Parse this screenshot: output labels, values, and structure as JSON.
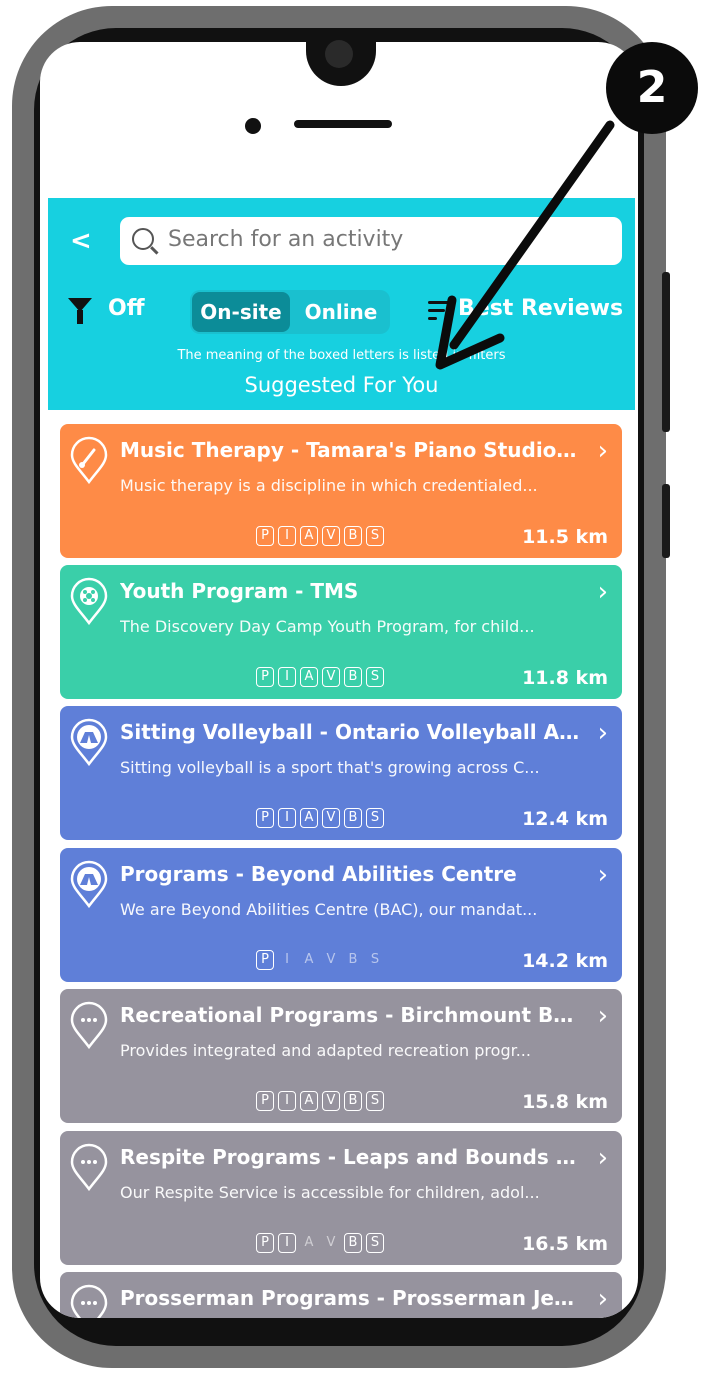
{
  "search": {
    "placeholder": "Search for an activity"
  },
  "filters": {
    "status": "Off",
    "mode_options": [
      "On-site",
      "Online"
    ],
    "mode_selected": "On-site",
    "sort_label": "Best Reviews"
  },
  "info_text": "The meaning of the boxed letters is listed in filters",
  "section_title": "Suggested For You",
  "badge_number": "2",
  "letter_keys": [
    "P",
    "I",
    "A",
    "V",
    "B",
    "S"
  ],
  "activities": [
    {
      "title": "Music Therapy - Tamara's Piano Studio a...",
      "description": "Music therapy is a discipline in which credentialed...",
      "distance": "11.5 km",
      "color": "#fe8b47",
      "icon": "paintbrush-pin-icon",
      "boxed": [
        true,
        true,
        true,
        true,
        true,
        true
      ]
    },
    {
      "title": "Youth Program - TMS",
      "description": "The Discovery Day Camp Youth Program, for child...",
      "distance": "11.8 km",
      "color": "#3acfa9",
      "icon": "flower-pin-icon",
      "boxed": [
        true,
        true,
        true,
        true,
        true,
        true
      ]
    },
    {
      "title": "Sitting Volleyball - Ontario Volleyball Ass...",
      "description": "Sitting volleyball is a sport that's growing across C...",
      "distance": "12.4 km",
      "color": "#5f7fd8",
      "icon": "tent-pin-icon",
      "boxed": [
        true,
        true,
        true,
        true,
        true,
        true
      ]
    },
    {
      "title": "Programs - Beyond Abilities Centre",
      "description": "We are Beyond Abilities Centre (BAC), our mandat...",
      "distance": "14.2 km",
      "color": "#5f7fd8",
      "icon": "tent-pin-icon",
      "boxed": [
        true,
        false,
        false,
        false,
        false,
        false
      ]
    },
    {
      "title": "Recreational Programs - Birchmount Bluff...",
      "description": "Provides integrated and adapted recreation progr...",
      "distance": "15.8 km",
      "color": "#96939e",
      "icon": "dots-pin-icon",
      "boxed": [
        true,
        true,
        true,
        true,
        true,
        true
      ]
    },
    {
      "title": "Respite Programs - Leaps and Bounds Se...",
      "description": "Our Respite Service is accessible for children, adol...",
      "distance": "16.5 km",
      "color": "#96939e",
      "icon": "dots-pin-icon",
      "boxed": [
        true,
        true,
        false,
        false,
        true,
        true
      ]
    },
    {
      "title": "Prosserman Programs - Prosserman Jewi...",
      "description": "",
      "distance": "",
      "color": "#96939e",
      "icon": "dots-pin-icon",
      "boxed": []
    }
  ]
}
